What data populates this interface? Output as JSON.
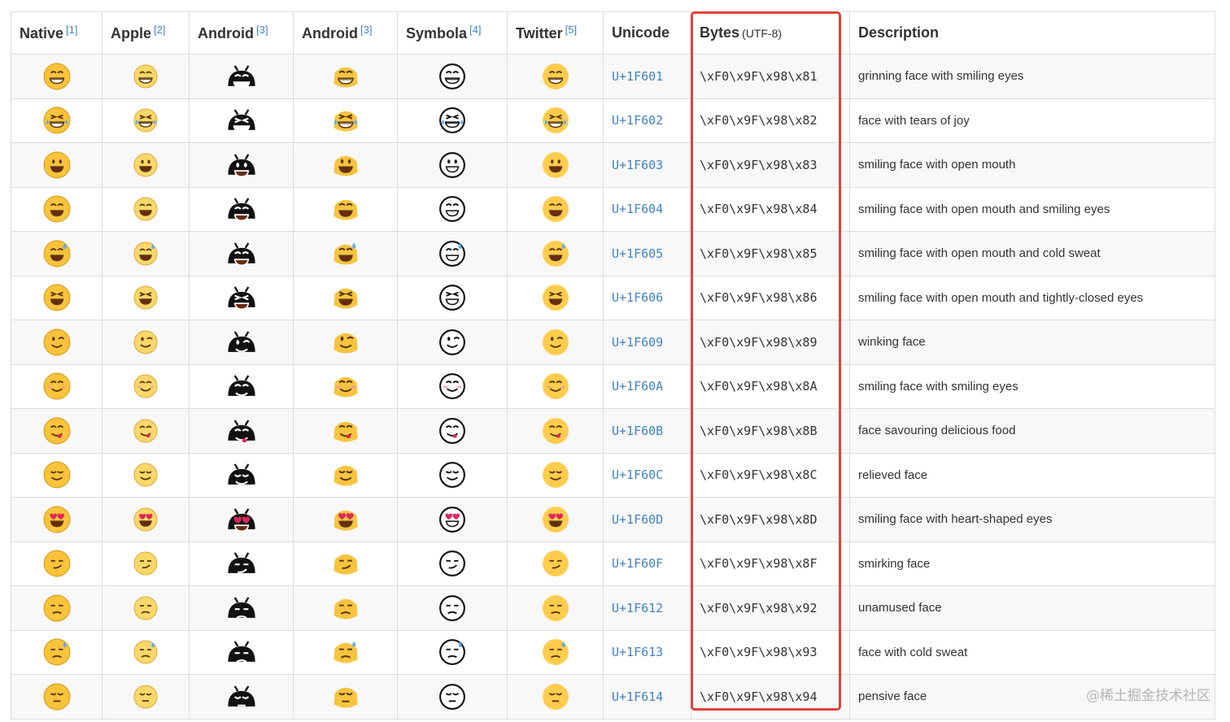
{
  "headers": [
    {
      "label": "Native",
      "ref": "[1]"
    },
    {
      "label": "Apple",
      "ref": "[2]"
    },
    {
      "label": "Android",
      "ref": "[3]"
    },
    {
      "label": "Android",
      "ref": "[3]"
    },
    {
      "label": "Symbola",
      "ref": "[4]"
    },
    {
      "label": "Twitter",
      "ref": "[5]"
    },
    {
      "label": "Unicode",
      "ref": ""
    },
    {
      "label": "Bytes",
      "ref": "",
      "sub": "(UTF-8)"
    },
    {
      "label": "Description",
      "ref": ""
    }
  ],
  "rows": [
    {
      "icon": "grinning-face-with-smiling-eyes-icon",
      "unicode": "U+1F601",
      "bytes": "\\xF0\\x9F\\x98\\x81",
      "description": "grinning face with smiling eyes"
    },
    {
      "icon": "face-with-tears-of-joy-icon",
      "unicode": "U+1F602",
      "bytes": "\\xF0\\x9F\\x98\\x82",
      "description": "face with tears of joy"
    },
    {
      "icon": "smiling-face-with-open-mouth-icon",
      "unicode": "U+1F603",
      "bytes": "\\xF0\\x9F\\x98\\x83",
      "description": "smiling face with open mouth"
    },
    {
      "icon": "smiling-face-open-mouth-smiling-eyes-icon",
      "unicode": "U+1F604",
      "bytes": "\\xF0\\x9F\\x98\\x84",
      "description": "smiling face with open mouth and smiling eyes"
    },
    {
      "icon": "smiling-face-open-mouth-cold-sweat-icon",
      "unicode": "U+1F605",
      "bytes": "\\xF0\\x9F\\x98\\x85",
      "description": "smiling face with open mouth and cold sweat"
    },
    {
      "icon": "smiling-face-open-mouth-closed-eyes-icon",
      "unicode": "U+1F606",
      "bytes": "\\xF0\\x9F\\x98\\x86",
      "description": "smiling face with open mouth and tightly-closed eyes"
    },
    {
      "icon": "winking-face-icon",
      "unicode": "U+1F609",
      "bytes": "\\xF0\\x9F\\x98\\x89",
      "description": "winking face"
    },
    {
      "icon": "smiling-face-with-smiling-eyes-icon",
      "unicode": "U+1F60A",
      "bytes": "\\xF0\\x9F\\x98\\x8A",
      "description": "smiling face with smiling eyes"
    },
    {
      "icon": "face-savouring-food-icon",
      "unicode": "U+1F60B",
      "bytes": "\\xF0\\x9F\\x98\\x8B",
      "description": "face savouring delicious food"
    },
    {
      "icon": "relieved-face-icon",
      "unicode": "U+1F60C",
      "bytes": "\\xF0\\x9F\\x98\\x8C",
      "description": "relieved face"
    },
    {
      "icon": "heart-eyes-face-icon",
      "unicode": "U+1F60D",
      "bytes": "\\xF0\\x9F\\x98\\x8D",
      "description": "smiling face with heart-shaped eyes"
    },
    {
      "icon": "smirking-face-icon",
      "unicode": "U+1F60F",
      "bytes": "\\xF0\\x9F\\x98\\x8F",
      "description": "smirking face"
    },
    {
      "icon": "unamused-face-icon",
      "unicode": "U+1F612",
      "bytes": "\\xF0\\x9F\\x98\\x92",
      "description": "unamused face"
    },
    {
      "icon": "face-with-cold-sweat-icon",
      "unicode": "U+1F613",
      "bytes": "\\xF0\\x9F\\x98\\x93",
      "description": "face with cold sweat"
    },
    {
      "icon": "pensive-face-icon",
      "unicode": "U+1F614",
      "bytes": "\\xF0\\x9F\\x98\\x94",
      "description": "pensive face"
    }
  ],
  "watermark": "@稀土掘金技术社区",
  "colors": {
    "highlight_border": "#e0423a",
    "link": "#4183c4",
    "row_stripe": "#f8f8f8",
    "emoji_yellow": "#f9c33c",
    "emoji_yellow_light": "#fbd86a",
    "android_black": "#111111"
  }
}
